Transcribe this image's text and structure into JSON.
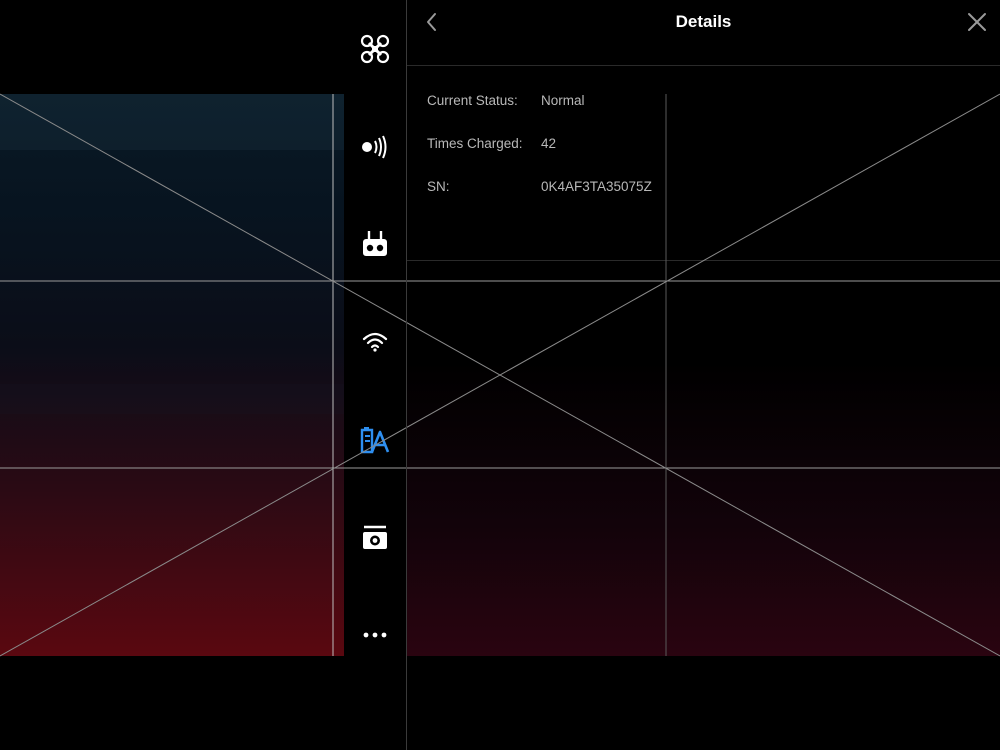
{
  "header": {
    "title": "Details"
  },
  "details": [
    {
      "label": "Current Status:",
      "value": "Normal"
    },
    {
      "label": "Times Charged:",
      "value": "42"
    },
    {
      "label": "SN:",
      "value": "0K4AF3TA35075Z"
    }
  ],
  "sidebar": {
    "items": [
      {
        "icon": "aircraft-icon"
      },
      {
        "icon": "signal-icon"
      },
      {
        "icon": "remote-controller-icon"
      },
      {
        "icon": "wifi-icon"
      },
      {
        "icon": "battery-icon",
        "active": true
      },
      {
        "icon": "camera-icon"
      },
      {
        "icon": "more-icon"
      }
    ]
  },
  "colors": {
    "accent": "#2e8ff0",
    "background": "#000000",
    "text_primary": "#ffffff",
    "text_secondary": "#b8b8b8"
  }
}
